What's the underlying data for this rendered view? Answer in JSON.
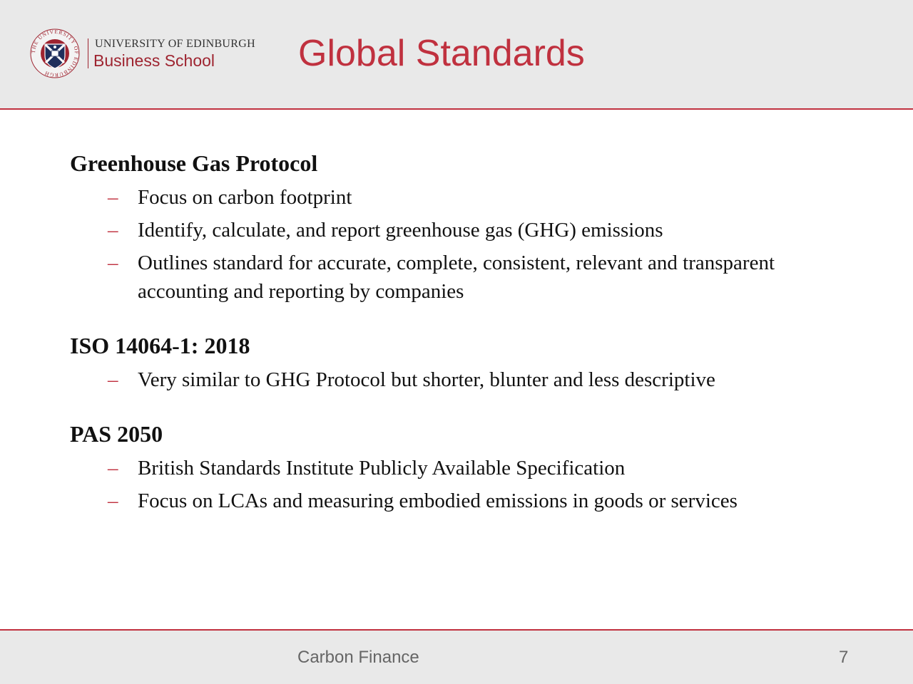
{
  "header": {
    "logo": {
      "line1": "UNIVERSITY OF EDINBURGH",
      "line2": "Business School",
      "crest_ring_text": "THE UNIVERSITY OF EDINBURGH"
    },
    "title": "Global Standards"
  },
  "sections": [
    {
      "heading": "Greenhouse Gas Protocol",
      "bullets": [
        "Focus on carbon footprint",
        "Identify, calculate, and report greenhouse gas (GHG) emissions",
        "Outlines standard for accurate, complete, consistent, relevant and transparent accounting and reporting by companies"
      ]
    },
    {
      "heading": "ISO 14064-1: 2018",
      "bullets": [
        "Very similar to GHG Protocol but shorter, blunter and less descriptive"
      ]
    },
    {
      "heading": "PAS 2050",
      "bullets": [
        "British Standards Institute Publicly Available Specification",
        "Focus on LCAs and measuring embodied emissions in goods or services"
      ]
    }
  ],
  "bullet_marker": "–",
  "footer": {
    "text": "Carbon Finance",
    "page_number": "7"
  },
  "colors": {
    "accent": "#c0313f",
    "logo_red": "#9e2430",
    "crest_navy": "#1f2f5c",
    "band_gray": "#e9e9e9",
    "text": "#111111",
    "footer_text": "#666666"
  }
}
